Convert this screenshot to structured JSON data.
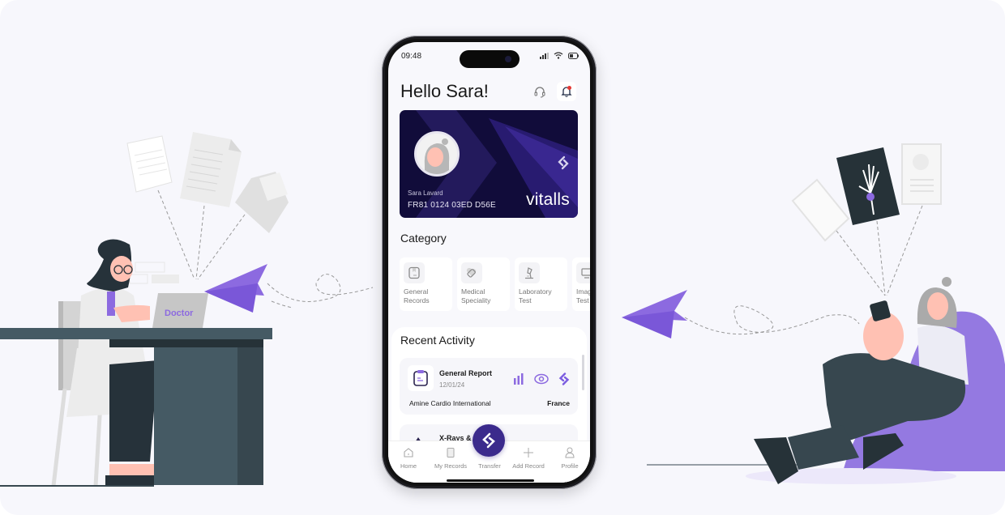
{
  "status_bar": {
    "time": "09:48"
  },
  "header": {
    "greeting": "Hello Sara!"
  },
  "card": {
    "holder_name": "Sara Lavard",
    "number": "FR81  0124  03ED  D56E",
    "brand": "vitalls"
  },
  "category": {
    "title": "Category",
    "items": [
      {
        "label": "General\nRecords",
        "icon": "records-icon"
      },
      {
        "label": "Medical\nSpeciality",
        "icon": "tag-heart-icon"
      },
      {
        "label": "Laboratory\nTest",
        "icon": "microscope-icon"
      },
      {
        "label": "Imaging\nTest",
        "icon": "monitor-icon"
      }
    ]
  },
  "recent_activity": {
    "title": "Recent Activity",
    "items": [
      {
        "title": "General Report",
        "date": "12/01/24",
        "organization": "Amine Cardio International",
        "country": "France"
      },
      {
        "title": "X-Rays & Scans"
      }
    ]
  },
  "tabbar": {
    "items": [
      {
        "label": "Home"
      },
      {
        "label": "My Records"
      },
      {
        "label": "Transfer"
      },
      {
        "label": "Add Record"
      },
      {
        "label": "Profile"
      }
    ]
  },
  "illustration": {
    "laptop_label": "Doctor"
  },
  "colors": {
    "accent": "#7b5ce0",
    "card_bg": "#110c3a",
    "fab": "#3b2a8c",
    "notification": "#e53935"
  }
}
